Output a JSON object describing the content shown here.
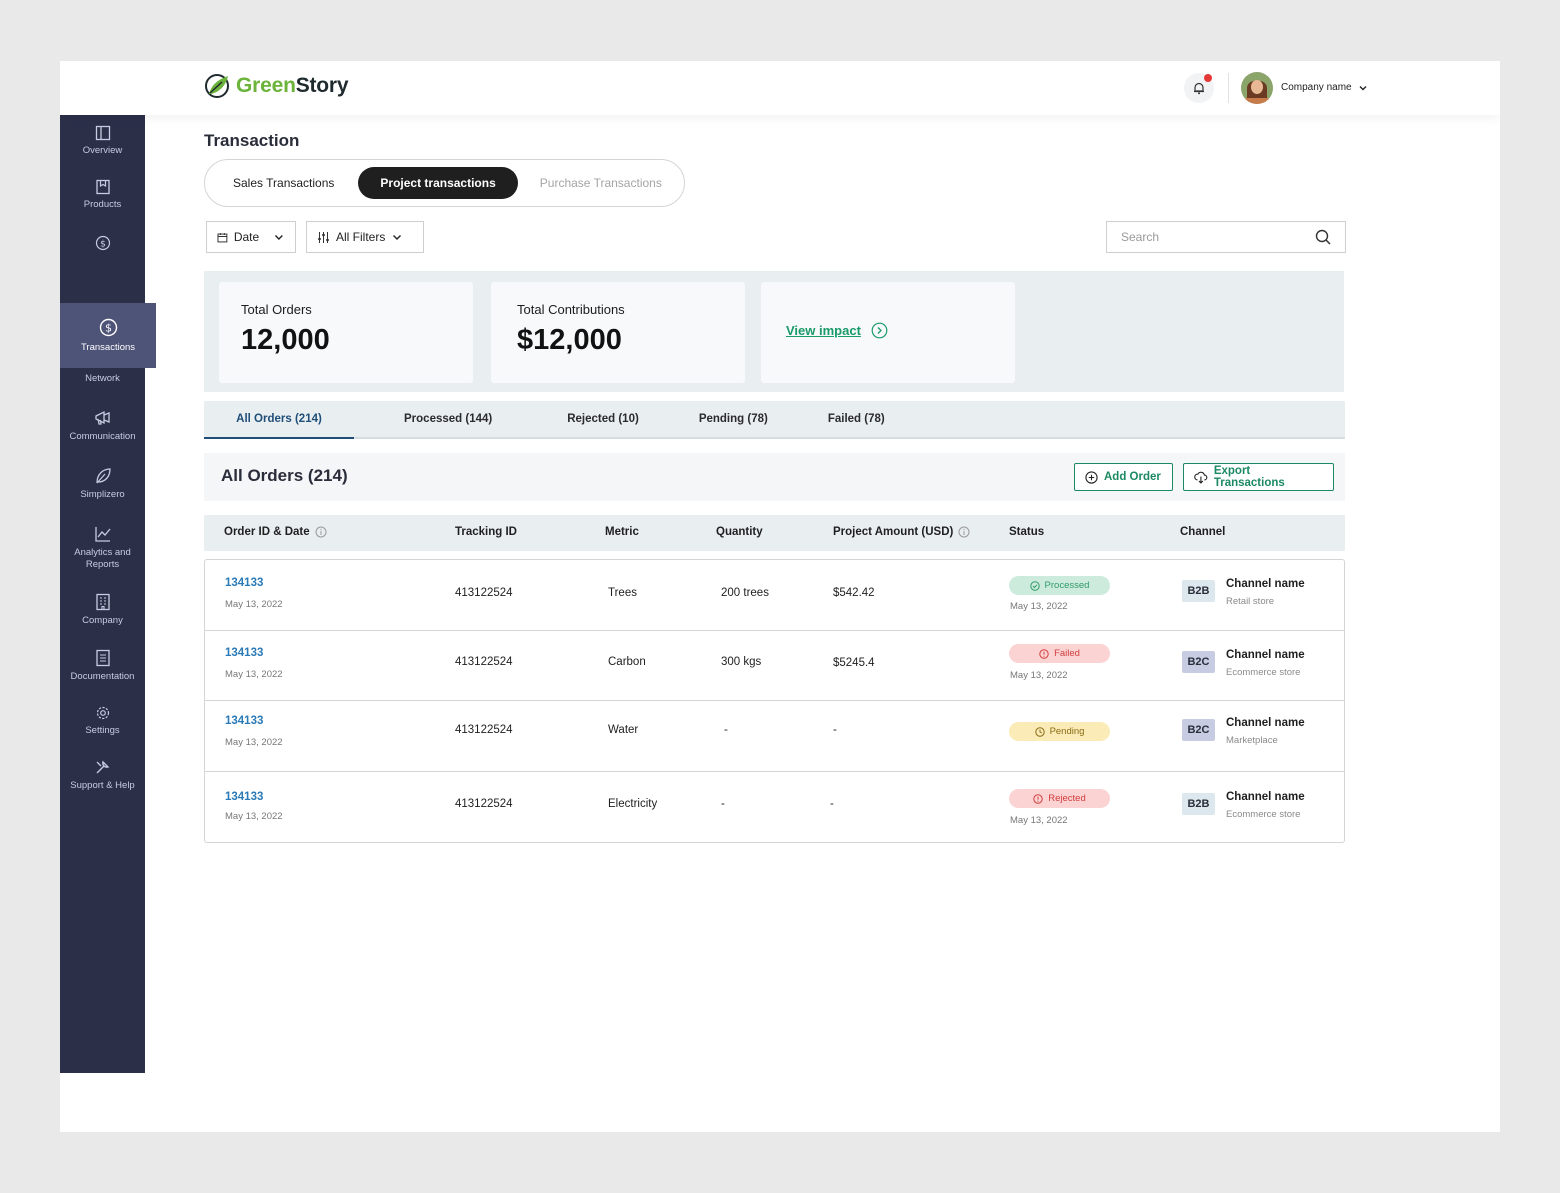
{
  "brand": {
    "name_part1": "Green",
    "name_part2": "Story"
  },
  "header": {
    "company_name": "Company name"
  },
  "sidebar": {
    "items": [
      {
        "label": "Overview",
        "icon": "layout-icon"
      },
      {
        "label": "Products",
        "icon": "bookmark-icon"
      },
      {
        "label": "Transactions",
        "icon": "dollar-circle-icon",
        "active": true
      },
      {
        "label": "Network",
        "icon": "network-icon"
      },
      {
        "label": "Communication",
        "icon": "megaphone-icon"
      },
      {
        "label": "Simplizero",
        "icon": "leaf-icon"
      },
      {
        "label": "Analytics and Reports",
        "icon": "chart-icon"
      },
      {
        "label": "Company",
        "icon": "building-icon"
      },
      {
        "label": "Documentation",
        "icon": "document-icon"
      },
      {
        "label": "Settings",
        "icon": "gear-icon"
      },
      {
        "label": "Support & Help",
        "icon": "wrench-icon"
      }
    ]
  },
  "page": {
    "title": "Transaction"
  },
  "segments": {
    "sales": "Sales Transactions",
    "project": "Project transactions",
    "purchase": "Purchase Transactions",
    "selected": "Project transactions"
  },
  "filters": {
    "date": "Date",
    "all": "All Filters",
    "search_placeholder": "Search"
  },
  "stats": {
    "total_orders_label": "Total Orders",
    "total_orders_value": "12,000",
    "total_contrib_label": "Total Contributions",
    "total_contrib_value": "$12,000",
    "view_impact": "View impact"
  },
  "tabs": [
    {
      "label": "All Orders (214)",
      "active": true
    },
    {
      "label": "Processed (144)"
    },
    {
      "label": "Rejected (10)"
    },
    {
      "label": "Pending (78)"
    },
    {
      "label": "Failed (78)"
    }
  ],
  "orders": {
    "title": "All Orders (214)",
    "add_order": "Add Order",
    "export": "Export Transactions"
  },
  "table": {
    "columns": {
      "order": "Order ID & Date",
      "tracking": "Tracking ID",
      "metric": "Metric",
      "quantity": "Quantity",
      "amount": "Project Amount (USD)",
      "status": "Status",
      "channel": "Channel"
    },
    "rows": [
      {
        "order_id": "134133",
        "date": "May 13, 2022",
        "tracking": "413122524",
        "metric": "Trees",
        "quantity": "200 trees",
        "amount": "$542.42",
        "status": "Processed",
        "status_date": "May 13, 2022",
        "channel_type": "B2B",
        "channel_name": "Channel name",
        "channel_sub": "Retail store"
      },
      {
        "order_id": "134133",
        "date": "May 13, 2022",
        "tracking": "413122524",
        "metric": "Carbon",
        "quantity": "300 kgs",
        "amount": "$5245.4",
        "status": "Failed",
        "status_date": "May 13, 2022",
        "channel_type": "B2C",
        "channel_name": "Channel name",
        "channel_sub": "Ecommerce store"
      },
      {
        "order_id": "134133",
        "date": "May 13, 2022",
        "tracking": "413122524",
        "metric": "Water",
        "quantity": "-",
        "amount": "-",
        "status": "Pending",
        "status_date": "",
        "channel_type": "B2C",
        "channel_name": "Channel name",
        "channel_sub": "Marketplace"
      },
      {
        "order_id": "134133",
        "date": "May 13, 2022",
        "tracking": "413122524",
        "metric": "Electricity",
        "quantity": "-",
        "amount": "-",
        "status": "Rejected",
        "status_date": "May 13, 2022",
        "channel_type": "B2B",
        "channel_name": "Channel name",
        "channel_sub": "Ecommerce store"
      }
    ]
  },
  "colors": {
    "sidebar": "#2b2f48",
    "sidebar_active": "#4e5378",
    "accent_green": "#1b8a63",
    "link_blue": "#2a7ab8"
  }
}
